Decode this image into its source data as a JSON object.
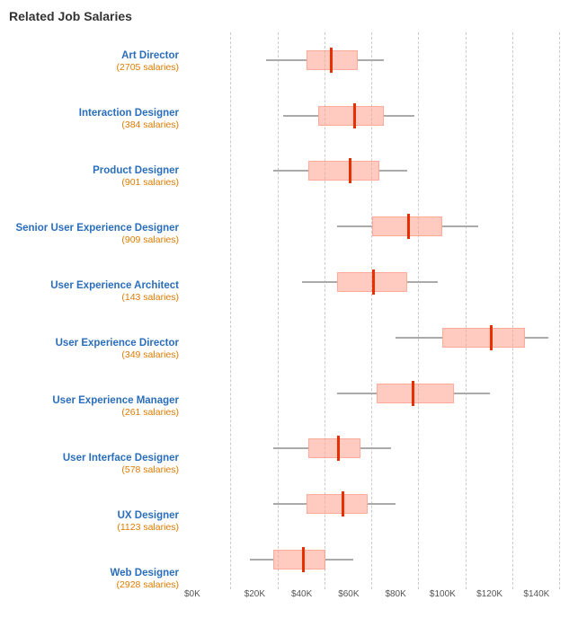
{
  "title": "Related Job Salaries",
  "xAxis": {
    "labels": [
      "$0K",
      "$20K",
      "$40K",
      "$60K",
      "$80K",
      "$100K",
      "$120K",
      "$140K"
    ]
  },
  "jobs": [
    {
      "title": "Art Director",
      "count": "2705 salaries",
      "whiskerLeft": 35,
      "boxLeft": 52,
      "median": 62,
      "boxRight": 74,
      "whiskerRight": 85
    },
    {
      "title": "Interaction Designer",
      "count": "384 salaries",
      "whiskerLeft": 42,
      "boxLeft": 57,
      "median": 72,
      "boxRight": 85,
      "whiskerRight": 98
    },
    {
      "title": "Product Designer",
      "count": "901 salaries",
      "whiskerLeft": 38,
      "boxLeft": 53,
      "median": 70,
      "boxRight": 83,
      "whiskerRight": 95
    },
    {
      "title": "Senior User Experience Designer",
      "count": "909 salaries",
      "whiskerLeft": 65,
      "boxLeft": 80,
      "median": 95,
      "boxRight": 110,
      "whiskerRight": 125
    },
    {
      "title": "User Experience Architect",
      "count": "143 salaries",
      "whiskerLeft": 50,
      "boxLeft": 65,
      "median": 80,
      "boxRight": 95,
      "whiskerRight": 108
    },
    {
      "title": "User Experience Director",
      "count": "349 salaries",
      "whiskerLeft": 90,
      "boxLeft": 110,
      "median": 130,
      "boxRight": 145,
      "whiskerRight": 155
    },
    {
      "title": "User Experience Manager",
      "count": "261 salaries",
      "whiskerLeft": 65,
      "boxLeft": 82,
      "median": 97,
      "boxRight": 115,
      "whiskerRight": 130
    },
    {
      "title": "User Interface Designer",
      "count": "578 salaries",
      "whiskerLeft": 38,
      "boxLeft": 53,
      "median": 65,
      "boxRight": 75,
      "whiskerRight": 88
    },
    {
      "title": "UX Designer",
      "count": "1123 salaries",
      "whiskerLeft": 38,
      "boxLeft": 52,
      "median": 67,
      "boxRight": 78,
      "whiskerRight": 90
    },
    {
      "title": "Web Designer",
      "count": "2928 salaries",
      "whiskerLeft": 28,
      "boxLeft": 38,
      "median": 50,
      "boxRight": 60,
      "whiskerRight": 72
    }
  ],
  "chart": {
    "minK": 0,
    "maxK": 160
  }
}
